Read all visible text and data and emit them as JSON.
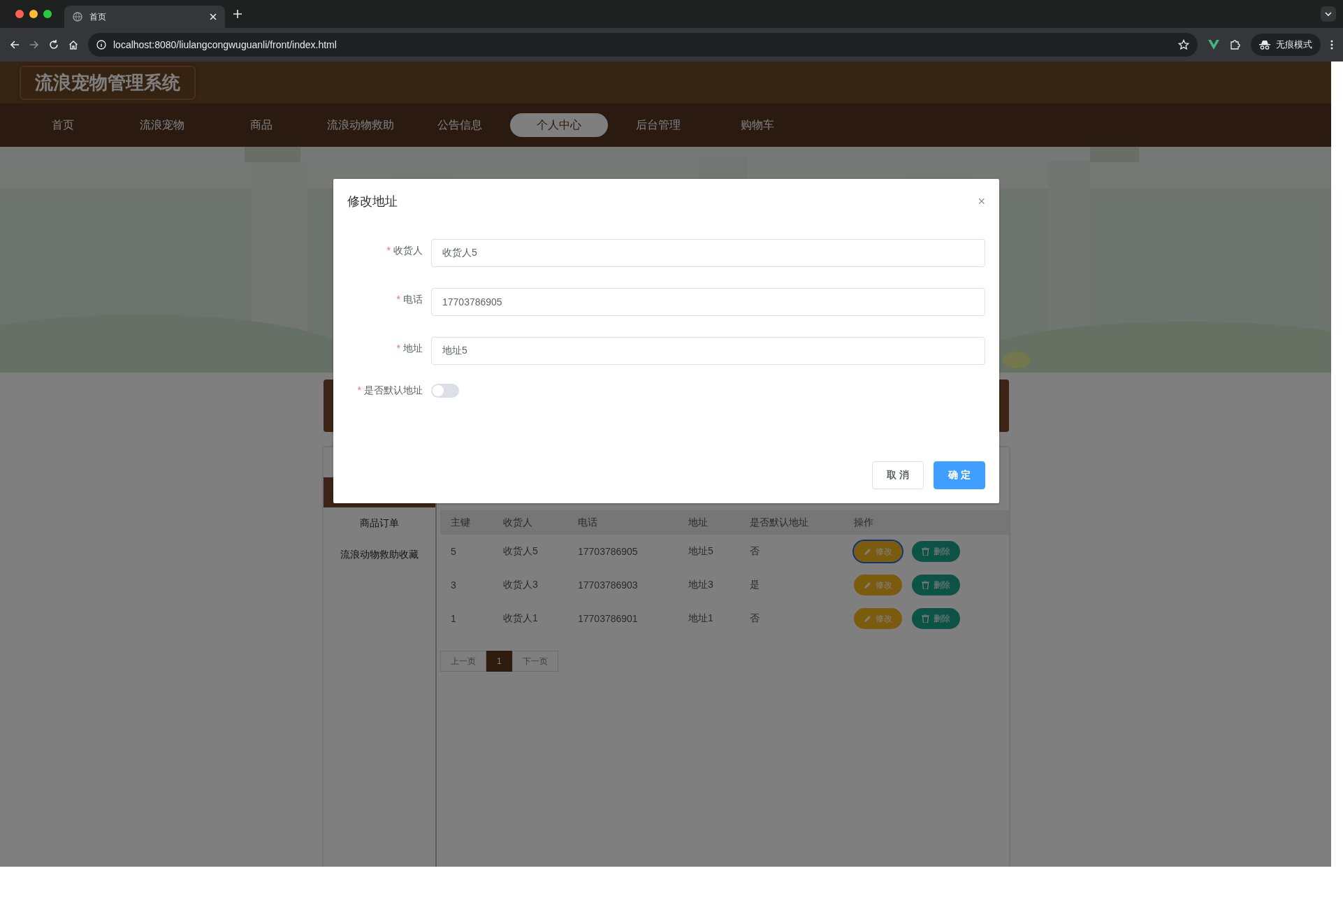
{
  "browser": {
    "tab_title": "首页",
    "url": "localhost:8080/liulangcongwuguanli/front/index.html",
    "profile_label": "无痕模式"
  },
  "site": {
    "title": "流浪宠物管理系统",
    "nav": [
      {
        "label": "首页",
        "selected": false
      },
      {
        "label": "流浪宠物",
        "selected": false
      },
      {
        "label": "商品",
        "selected": false
      },
      {
        "label": "流浪动物救助",
        "selected": false
      },
      {
        "label": "公告信息",
        "selected": false
      },
      {
        "label": "个人中心",
        "selected": true
      },
      {
        "label": "后台管理",
        "selected": false
      },
      {
        "label": "购物车",
        "selected": false
      }
    ]
  },
  "sidebar": {
    "items": [
      {
        "label": "商品订单",
        "selected": false
      },
      {
        "label": "流浪动物救助收藏",
        "selected": false
      }
    ]
  },
  "table": {
    "columns": [
      "主键",
      "收货人",
      "电话",
      "地址",
      "是否默认地址",
      "操作"
    ],
    "rows": [
      {
        "cells": [
          "5",
          "收货人5",
          "17703786905",
          "地址5",
          "否"
        ],
        "actions": [
          "修改",
          "删除"
        ],
        "focused": true
      },
      {
        "cells": [
          "3",
          "收货人3",
          "17703786903",
          "地址3",
          "是"
        ],
        "actions": [
          "修改",
          "删除"
        ],
        "focused": false
      },
      {
        "cells": [
          "1",
          "收货人1",
          "17703786901",
          "地址1",
          "否"
        ],
        "actions": [
          "修改",
          "删除"
        ],
        "focused": false
      }
    ]
  },
  "pagination": {
    "prev": "上一页",
    "next": "下一页",
    "prev_disabled": true,
    "next_disabled": true,
    "pages": [
      {
        "label": "1",
        "selected": true
      }
    ]
  },
  "dialog": {
    "title": "修改地址",
    "close": "×",
    "required_mark": "*",
    "fields": [
      {
        "kind": "text",
        "label": "收货人",
        "required": true,
        "value": "收货人5"
      },
      {
        "kind": "text",
        "label": "电话",
        "required": true,
        "value": "17703786905"
      },
      {
        "kind": "text",
        "label": "地址",
        "required": true,
        "value": "地址5"
      },
      {
        "kind": "switch",
        "label": "是否默认地址",
        "required": true,
        "on": false
      }
    ],
    "buttons": [
      {
        "kind": "default",
        "label": "取 消"
      },
      {
        "kind": "primary",
        "label": "确 定"
      }
    ]
  }
}
